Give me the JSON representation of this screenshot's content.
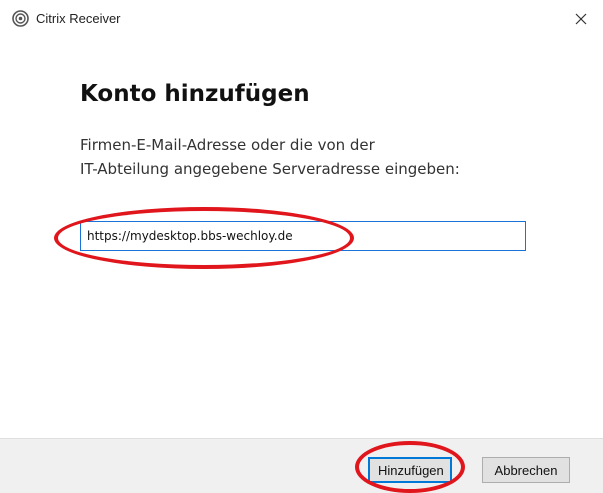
{
  "window": {
    "title": "Citrix Receiver",
    "close_glyph": "×"
  },
  "dialog": {
    "heading": "Konto hinzufügen",
    "description_line1": "Firmen-E-Mail-Adresse oder die von der",
    "description_line2": "IT-Abteilung angegebene Serveradresse eingeben:",
    "server_address_value": "https://mydesktop.bbs-wechloy.de",
    "server_address_placeholder": ""
  },
  "buttons": {
    "add_label": "Hinzufügen",
    "cancel_label": "Abbrechen"
  },
  "icons": {
    "app": "citrix-receiver-icon",
    "close": "close-icon"
  },
  "colors": {
    "annotation": "#e0161c",
    "focus_border": "#0078d7",
    "input_border": "#1a73d9",
    "footer_bg": "#f0f0f0"
  }
}
